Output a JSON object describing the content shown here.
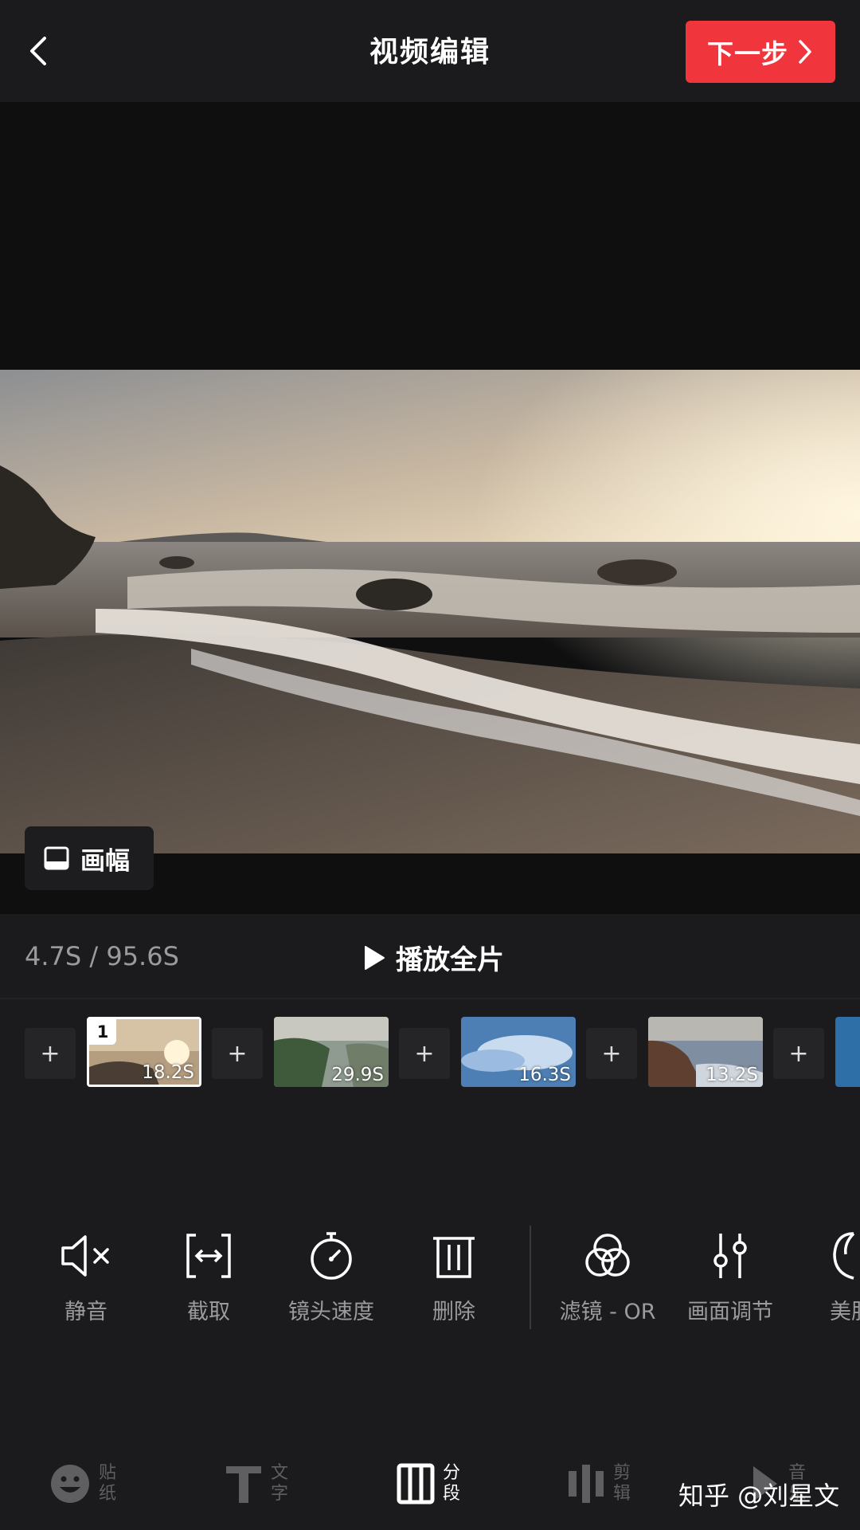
{
  "header": {
    "title": "视频编辑",
    "next_label": "下一步"
  },
  "preview": {
    "aspect_label": "画幅"
  },
  "playback": {
    "time": "4.7S / 95.6S",
    "play_all_label": "播放全片"
  },
  "clips": [
    {
      "index": "1",
      "duration": "18.2S",
      "selected": true
    },
    {
      "duration": "29.9S"
    },
    {
      "duration": "16.3S"
    },
    {
      "duration": "13.2S"
    }
  ],
  "tools": [
    {
      "label": "静音",
      "icon": "mute-icon"
    },
    {
      "label": "截取",
      "icon": "trim-icon"
    },
    {
      "label": "镜头速度",
      "icon": "speed-icon"
    },
    {
      "label": "删除",
      "icon": "delete-icon"
    },
    {
      "label": "滤镜 - OR",
      "icon": "filter-icon"
    },
    {
      "label": "画面调节",
      "icon": "adjust-icon"
    },
    {
      "label": "美肤",
      "icon": "beauty-icon"
    }
  ],
  "bottom_nav": [
    {
      "label": "贴纸",
      "icon": "sticker-icon"
    },
    {
      "label": "文字",
      "icon": "text-icon"
    },
    {
      "label": "分段",
      "icon": "segment-icon",
      "active": true
    },
    {
      "label": "剪辑",
      "icon": "edit-icon"
    },
    {
      "label": "音乐",
      "icon": "music-icon"
    }
  ],
  "watermark": "知乎 @刘星文",
  "colors": {
    "accent": "#f0353c",
    "background": "#0f0f10",
    "panel": "#1b1b1d"
  }
}
